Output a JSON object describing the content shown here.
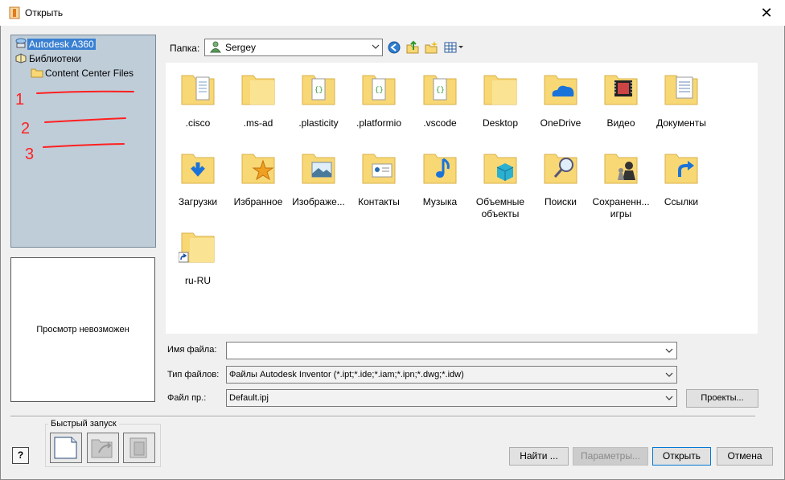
{
  "window": {
    "title": "Открыть",
    "close_glyph": "✕"
  },
  "locations": [
    {
      "label": "Autodesk A360",
      "icon": "cloud-computer-icon",
      "selected": true
    },
    {
      "label": "Библиотеки",
      "icon": "library-icon",
      "selected": false
    },
    {
      "label": "Content Center Files",
      "icon": "folder-icon",
      "selected": false
    }
  ],
  "annotations": [
    "1",
    "2",
    "3"
  ],
  "preview_text": "Просмотр невозможен",
  "toolbar": {
    "folder_label": "Папка:",
    "folder_value": "Sergey",
    "buttons": [
      "back-icon",
      "up-folder-icon",
      "new-folder-icon",
      "view-menu-icon"
    ]
  },
  "files": [
    {
      "name": ".cisco",
      "icon": "document-folder-icon"
    },
    {
      "name": ".ms-ad",
      "icon": "folder-icon"
    },
    {
      "name": ".plasticity",
      "icon": "code-folder-icon"
    },
    {
      "name": ".platformio",
      "icon": "code-folder-icon"
    },
    {
      "name": ".vscode",
      "icon": "code-folder-icon"
    },
    {
      "name": "Desktop",
      "icon": "folder-icon"
    },
    {
      "name": "OneDrive",
      "icon": "onedrive-folder-icon"
    },
    {
      "name": "Видео",
      "icon": "video-folder-icon"
    },
    {
      "name": "Документы",
      "icon": "documents-folder-icon"
    },
    {
      "name": "Загрузки",
      "icon": "downloads-folder-icon"
    },
    {
      "name": "Избранное",
      "icon": "favorites-folder-icon"
    },
    {
      "name": "Изображе...",
      "icon": "pictures-folder-icon"
    },
    {
      "name": "Контакты",
      "icon": "contacts-folder-icon"
    },
    {
      "name": "Музыка",
      "icon": "music-folder-icon"
    },
    {
      "name": "Объемные объекты",
      "icon": "3d-objects-folder-icon"
    },
    {
      "name": "Поиски",
      "icon": "searches-folder-icon"
    },
    {
      "name": "Сохраненн... игры",
      "icon": "saved-games-folder-icon"
    },
    {
      "name": "Ссылки",
      "icon": "links-folder-icon"
    },
    {
      "name": "ru-RU",
      "icon": "shortcut-folder-icon"
    }
  ],
  "form": {
    "filename_label": "Имя файла:",
    "filename_value": "",
    "filetype_label": "Тип файлов:",
    "filetype_value": "Файлы Autodesk Inventor (*.ipt;*.ide;*.iam;*.ipn;*.dwg;*.idw)",
    "project_label": "Файл пр.:",
    "project_value": "Default.ipj",
    "projects_button": "Проекты..."
  },
  "quick_launch": {
    "label": "Быстрый запуск"
  },
  "help_glyph": "?",
  "buttons": {
    "find": "Найти ...",
    "options": "Параметры...",
    "open": "Открыть",
    "cancel": "Отмена"
  },
  "colors": {
    "selection": "#3a80d2",
    "panel": "#bfcdd9",
    "folder": "#f8d775",
    "annotation": "#ff0000"
  }
}
